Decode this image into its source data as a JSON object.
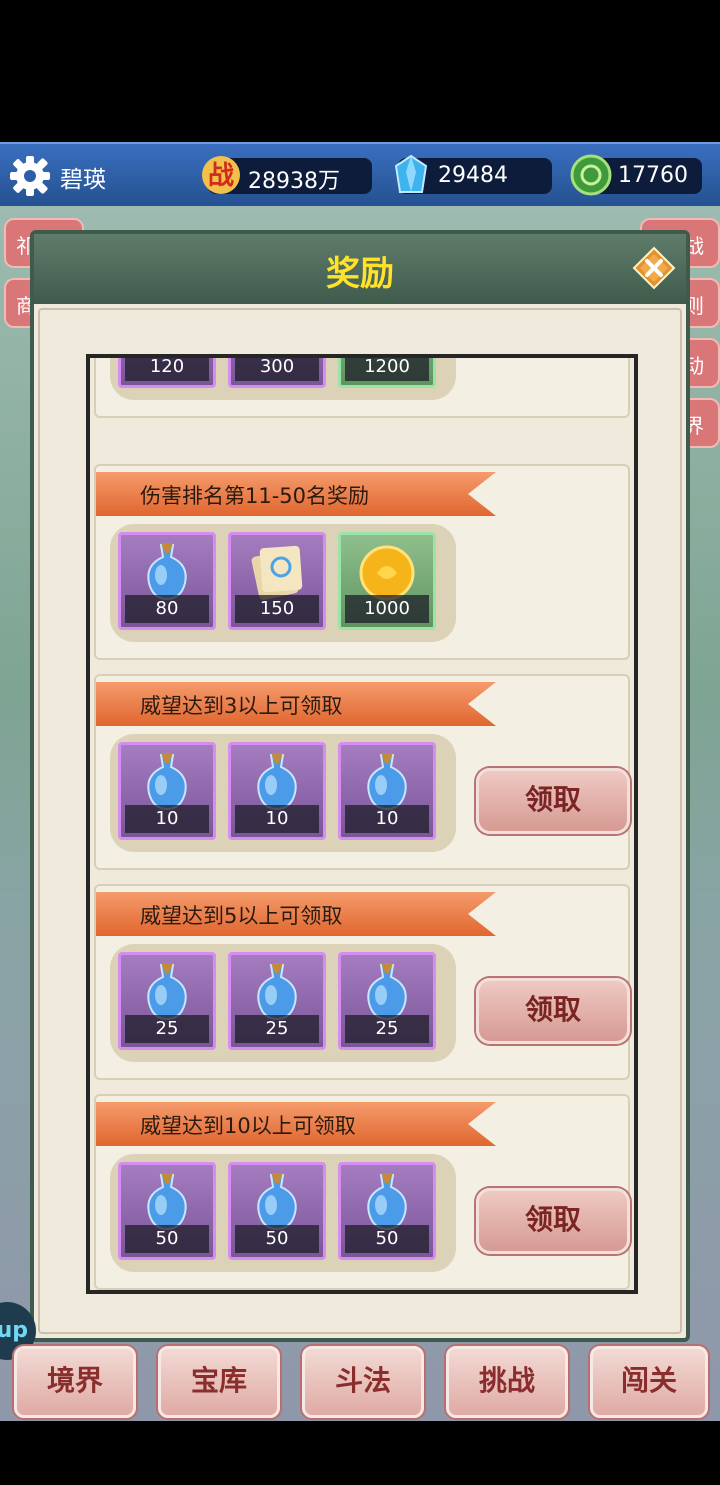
{
  "topbar": {
    "player_name": "碧瑛",
    "combat_power": "28938万",
    "gems": "29484",
    "jade": "17760",
    "combat_badge": "战"
  },
  "side_tags": [
    "祁",
    "商",
    "战",
    "则",
    "动",
    "界"
  ],
  "modal": {
    "title": "奖励",
    "sections": [
      {
        "heading": "",
        "items": [
          {
            "icon": "potion-icon",
            "qty": "120"
          },
          {
            "icon": "scroll-icon",
            "qty": "300"
          },
          {
            "icon": "gold-coin-icon",
            "qty": "1200"
          }
        ],
        "claim": ""
      },
      {
        "heading": "伤害排名第11-50名奖励",
        "items": [
          {
            "icon": "potion-icon",
            "qty": "80"
          },
          {
            "icon": "scroll-icon",
            "qty": "150"
          },
          {
            "icon": "gold-coin-icon",
            "qty": "1000"
          }
        ],
        "claim": ""
      },
      {
        "heading": "威望达到3以上可领取",
        "items": [
          {
            "icon": "potion-icon",
            "qty": "10"
          },
          {
            "icon": "potion-icon",
            "qty": "10"
          },
          {
            "icon": "potion-icon",
            "qty": "10"
          }
        ],
        "claim": "领取"
      },
      {
        "heading": "威望达到5以上可领取",
        "items": [
          {
            "icon": "potion-icon",
            "qty": "25"
          },
          {
            "icon": "potion-icon",
            "qty": "25"
          },
          {
            "icon": "potion-icon",
            "qty": "25"
          }
        ],
        "claim": "领取"
      },
      {
        "heading": "威望达到10以上可领取",
        "items": [
          {
            "icon": "potion-icon",
            "qty": "50"
          },
          {
            "icon": "potion-icon",
            "qty": "50"
          },
          {
            "icon": "potion-icon",
            "qty": "50"
          }
        ],
        "claim": "领取"
      }
    ]
  },
  "bottom_nav": [
    "境界",
    "宝库",
    "斗法",
    "挑战",
    "闯关"
  ],
  "bubble_text": "up",
  "colors": {
    "modal_header": "#3f5b4c",
    "title": "#ffe229",
    "ribbon": "#e0662f",
    "item_rare": "#d58df0",
    "item_gold": "#9be3a6"
  }
}
